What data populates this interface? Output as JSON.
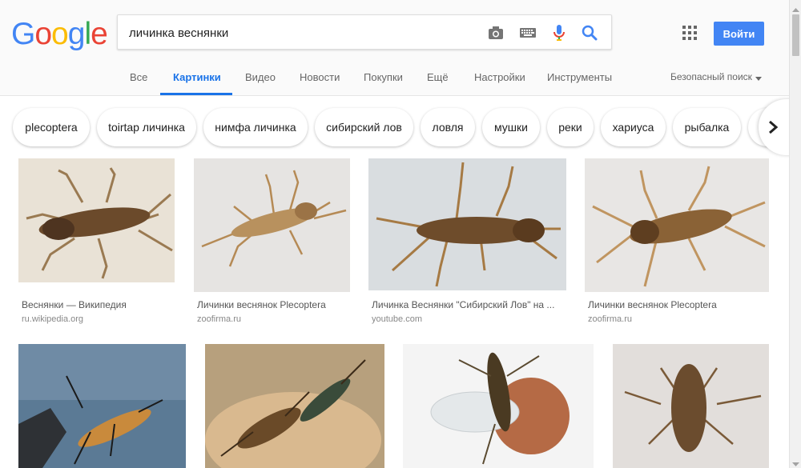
{
  "logo": {
    "letters": [
      "G",
      "o",
      "o",
      "g",
      "l",
      "e"
    ],
    "colors": [
      "#4285f4",
      "#ea4335",
      "#fbbc05",
      "#4285f4",
      "#34a853",
      "#ea4335"
    ]
  },
  "search": {
    "query": "личинка веснянки",
    "icons": [
      "camera-icon",
      "keyboard-icon",
      "mic-icon",
      "search-icon"
    ]
  },
  "header": {
    "signin_label": "Войти",
    "apps_icon": "apps-grid-icon",
    "accent": "#4285f4"
  },
  "tabs": [
    {
      "label": "Все"
    },
    {
      "label": "Картинки",
      "active": true
    },
    {
      "label": "Видео"
    },
    {
      "label": "Новости"
    },
    {
      "label": "Покупки"
    },
    {
      "label": "Ещё"
    },
    {
      "label": "Настройки"
    },
    {
      "label": "Инструменты"
    }
  ],
  "safe_search": {
    "label": "Безопасный поиск",
    "icon": "caret-down-icon"
  },
  "chips": [
    "plecoptera",
    "toirtap личинка",
    "нимфа личинка",
    "сибирский лов",
    "ловля",
    "мушки",
    "реки",
    "хариуса",
    "рыбалка"
  ],
  "results": [
    {
      "title": "Веснянки — Википедия",
      "source": "ru.wikipedia.org"
    },
    {
      "title": "Личинки веснянок Plecoptera",
      "source": "zoofirma.ru"
    },
    {
      "title": "Личинка Веснянки \"Сибирский Лов\" на ...",
      "source": "youtube.com"
    },
    {
      "title": "Личинки веснянок Plecoptera",
      "source": "zoofirma.ru"
    },
    {},
    {},
    {},
    {}
  ]
}
